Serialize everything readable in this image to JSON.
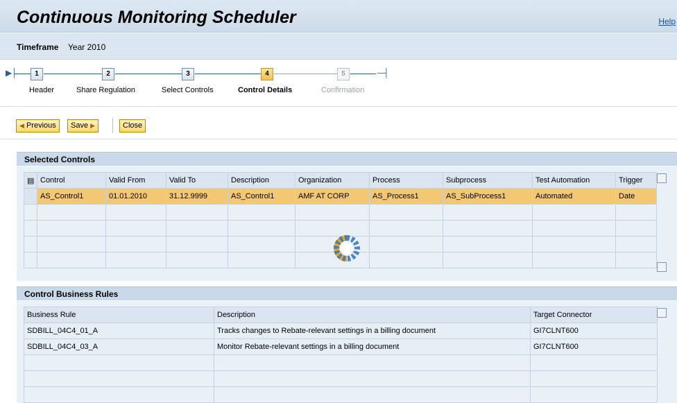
{
  "header": {
    "title": "Continuous Monitoring Scheduler",
    "help": "Help"
  },
  "timeframe": {
    "label": "Timeframe",
    "value": "Year 2010"
  },
  "roadmap": {
    "steps": [
      {
        "num": "1",
        "label": "Header"
      },
      {
        "num": "2",
        "label": "Share Regulation"
      },
      {
        "num": "3",
        "label": "Select Controls"
      },
      {
        "num": "4",
        "label": "Control Details"
      },
      {
        "num": "5",
        "label": "Confirmation"
      }
    ],
    "start_icon": "roadmap-start-icon",
    "end_icon": "roadmap-end-icon"
  },
  "toolbar": {
    "previous": "Previous",
    "save": "Save",
    "close": "Close"
  },
  "selected_controls": {
    "title": "Selected Controls",
    "columns": [
      "Control",
      "Valid From",
      "Valid To",
      "Description",
      "Organization",
      "Process",
      "Subprocess",
      "Test Automation",
      "Trigger"
    ],
    "rows": [
      [
        "AS_Control1",
        "01.01.2010",
        "31.12.9999",
        "AS_Control1",
        "AMF AT CORP",
        "AS_Process1",
        "AS_SubProcess1",
        "Automated",
        "Date"
      ]
    ]
  },
  "business_rules": {
    "title": "Control Business Rules",
    "columns": [
      "Business Rule",
      "Description",
      "Target Connector"
    ],
    "rows": [
      [
        "SDBILL_04C4_01_A",
        "Tracks changes to Rebate-relevant settings in a billing document",
        "GI7CLNT600"
      ],
      [
        "SDBILL_04C4_03_A",
        "Monitor Rebate-relevant settings in a billing document",
        "GI7CLNT600"
      ]
    ]
  },
  "icons": {
    "loading": "loading-spinner-icon",
    "column_settings": "table-settings-icon"
  },
  "colors": {
    "selected_row": "#f3c873",
    "active_step": "#f3c04d",
    "header_bg": "#cddbe8"
  }
}
